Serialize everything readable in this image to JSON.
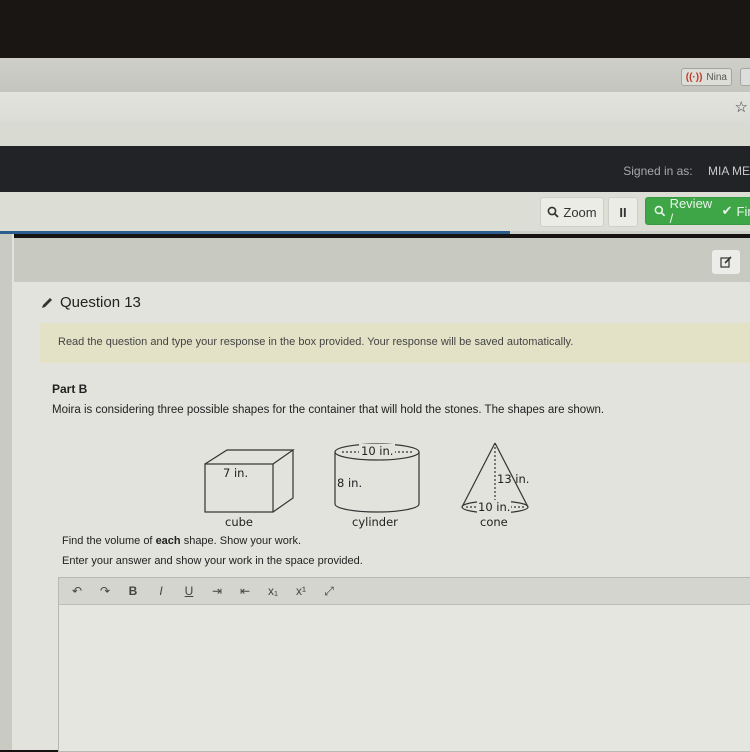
{
  "browser": {
    "extension_label": "Nina",
    "extension_icon": "signal-icon",
    "bookmark_icon": "star-icon"
  },
  "header": {
    "signed_in_label": "Signed in as:",
    "user_name": "MIA ME"
  },
  "toolbar": {
    "zoom_label": "Zoom",
    "pause_label": "II",
    "review_label": "Review /",
    "finish_label": "Finis",
    "progress_fraction": 0.68
  },
  "question": {
    "title": "Question 13",
    "notice": "Read the question and type your response in the box provided. Your response will be saved automatically.",
    "part": "Part B",
    "stem": "Moira is considering three possible shapes for the container that will hold the stones. The shapes are shown.",
    "figures": {
      "cube": {
        "name": "cube",
        "dimension": "7 in."
      },
      "cylinder": {
        "name": "cylinder",
        "diameter": "10 in.",
        "height": "8 in."
      },
      "cone": {
        "name": "cone",
        "diameter": "10 in.",
        "height": "13 in."
      }
    },
    "instruction_pre": "Find the volume of ",
    "instruction_bold": "each",
    "instruction_post": " shape. Show your work.",
    "instruction2": "Enter your answer and show your work in the space provided."
  },
  "editor": {
    "tools": [
      {
        "name": "undo",
        "glyph": "↶"
      },
      {
        "name": "redo",
        "glyph": "↷"
      },
      {
        "name": "bold",
        "glyph": "B"
      },
      {
        "name": "italic",
        "glyph": "I"
      },
      {
        "name": "underline",
        "glyph": "U"
      },
      {
        "name": "indent",
        "glyph": "⇥"
      },
      {
        "name": "outdent",
        "glyph": "⇤"
      },
      {
        "name": "subscript",
        "glyph": "x₁"
      },
      {
        "name": "superscript",
        "glyph": "x¹"
      },
      {
        "name": "fullscreen",
        "glyph": "⤢"
      }
    ],
    "value": ""
  }
}
